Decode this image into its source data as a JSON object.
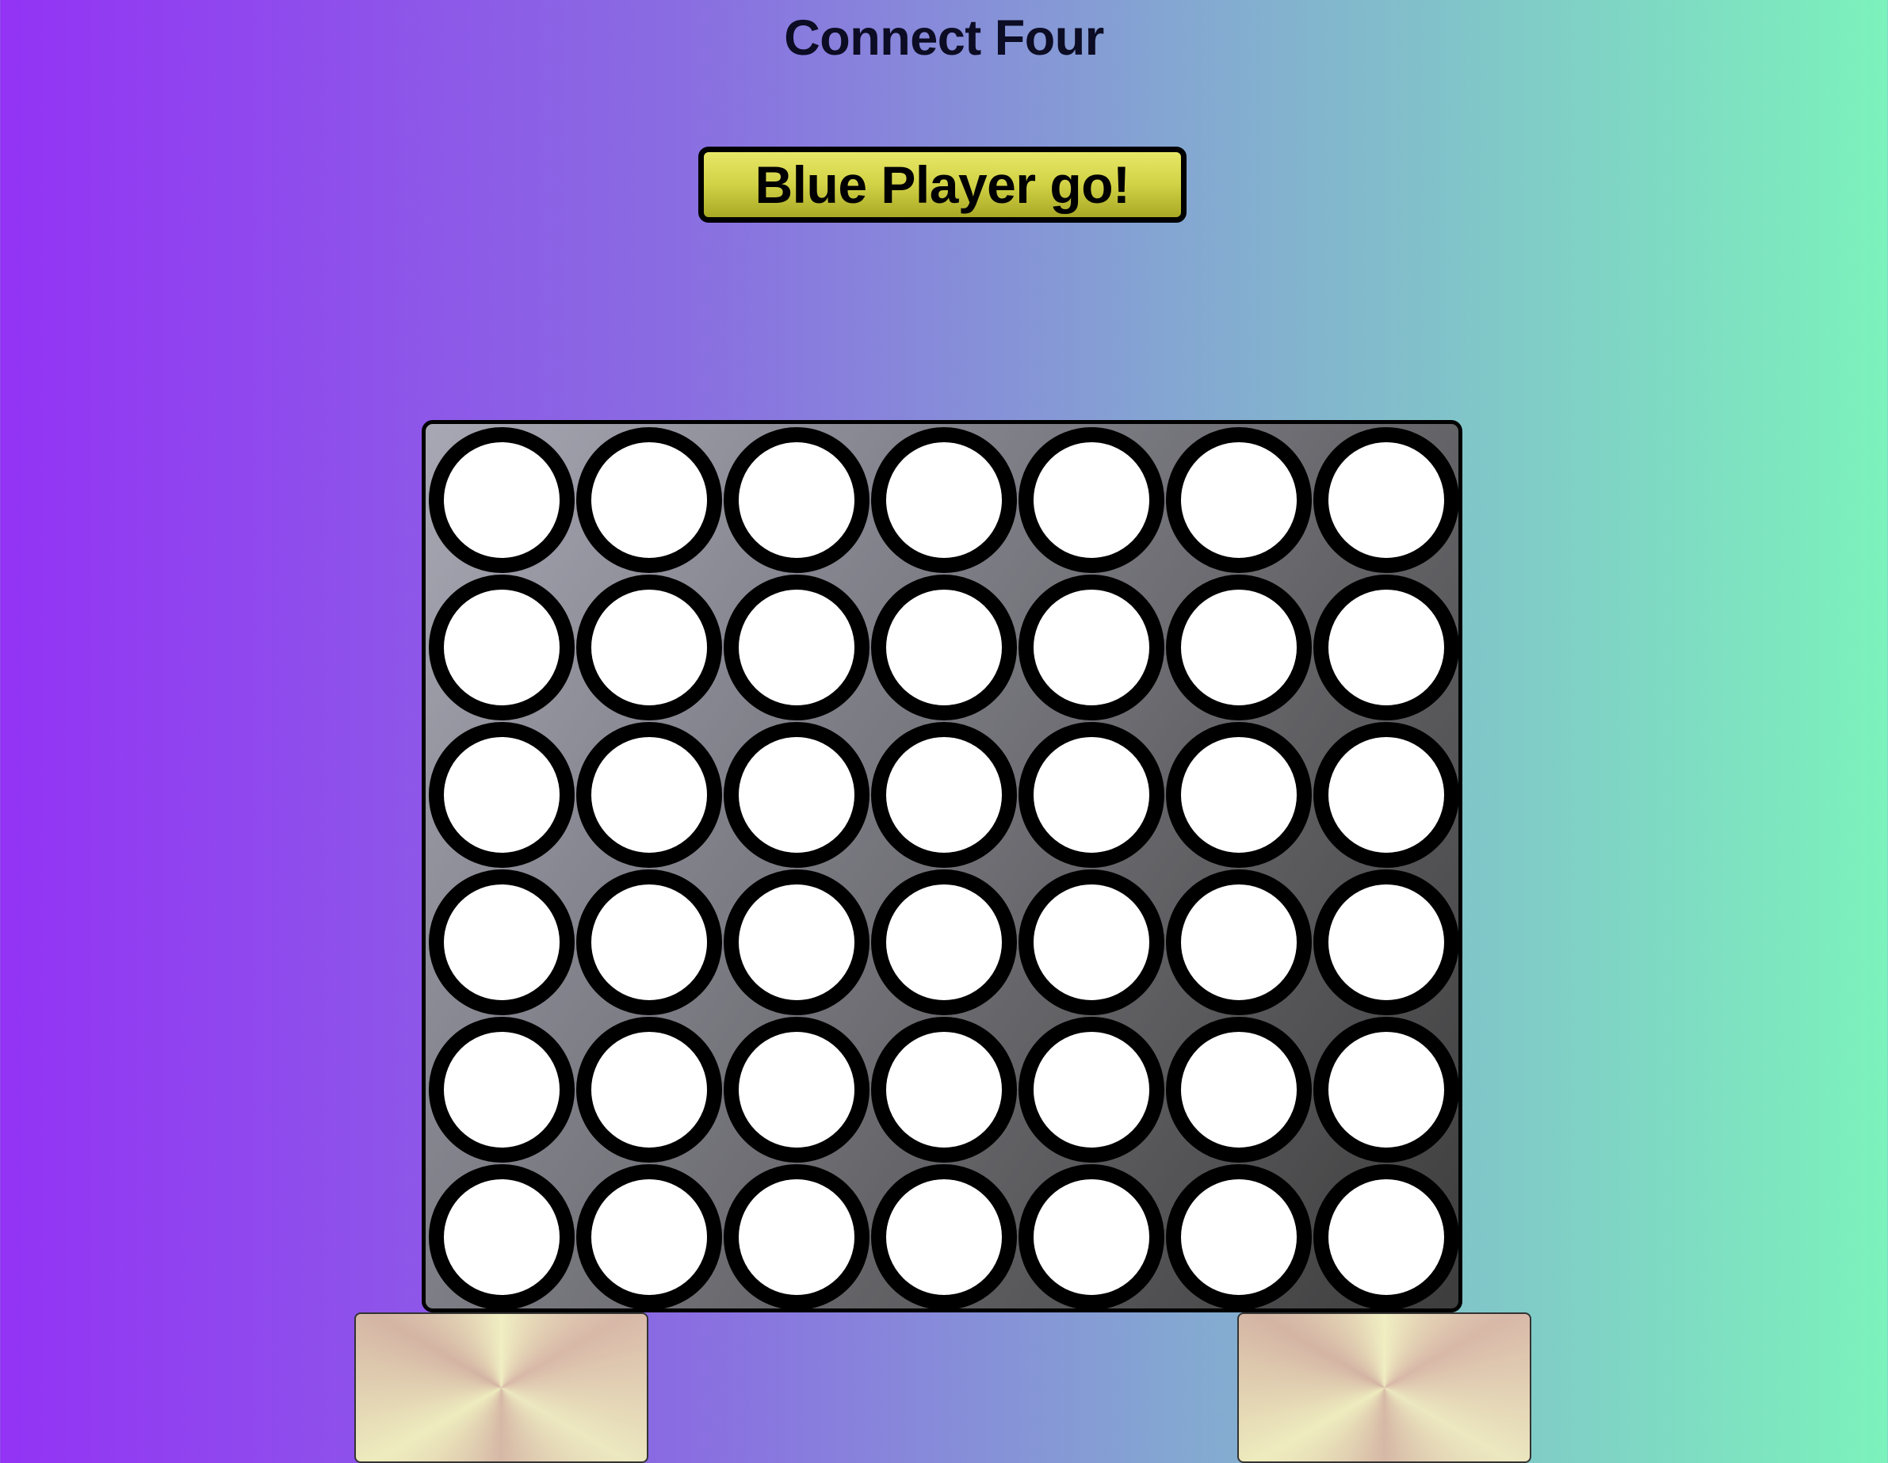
{
  "game": {
    "title": "Connect Four",
    "status": "Blue Player go!",
    "board": {
      "rows": 6,
      "columns": 7,
      "cells": [
        [
          "empty",
          "empty",
          "empty",
          "empty",
          "empty",
          "empty",
          "empty"
        ],
        [
          "empty",
          "empty",
          "empty",
          "empty",
          "empty",
          "empty",
          "empty"
        ],
        [
          "empty",
          "empty",
          "empty",
          "empty",
          "empty",
          "empty",
          "empty"
        ],
        [
          "empty",
          "empty",
          "empty",
          "empty",
          "empty",
          "empty",
          "empty"
        ],
        [
          "empty",
          "empty",
          "empty",
          "empty",
          "empty",
          "empty",
          "empty"
        ],
        [
          "empty",
          "empty",
          "empty",
          "empty",
          "empty",
          "empty",
          "empty"
        ]
      ]
    },
    "colors": {
      "board": "#66666a",
      "empty_slot": "#ffffff",
      "button": "#d2d246",
      "background_start": "#9333f5",
      "background_end": "#7cf2bc"
    }
  }
}
